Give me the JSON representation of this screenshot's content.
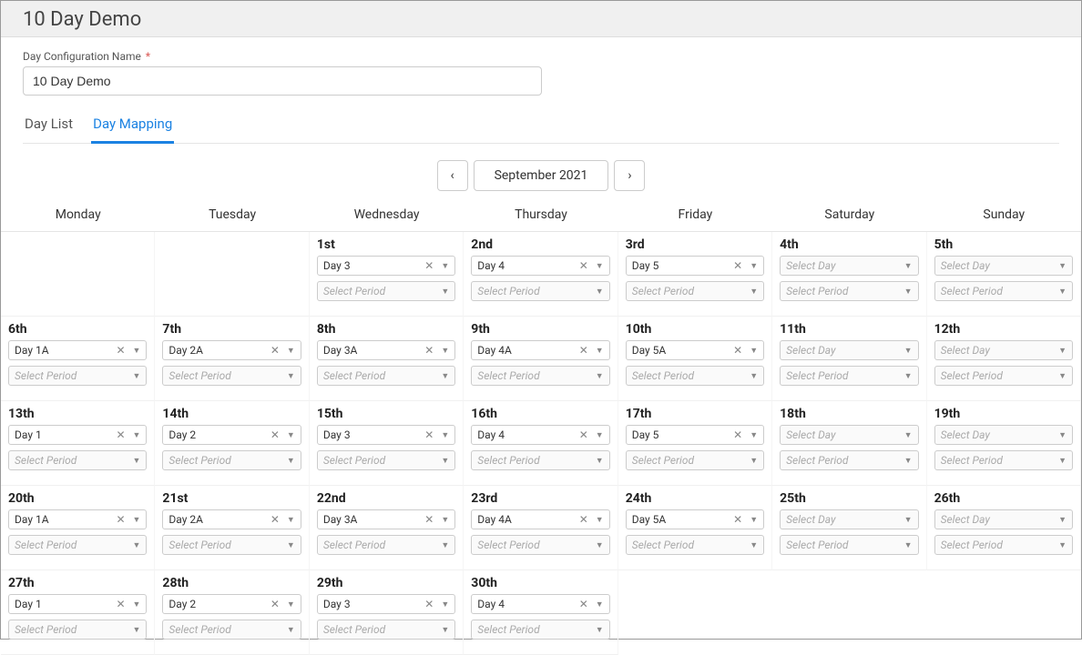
{
  "header": {
    "title": "10 Day Demo"
  },
  "config": {
    "label": "Day Configuration Name",
    "required_marker": "*",
    "value": "10 Day Demo"
  },
  "tabs": {
    "day_list": "Day List",
    "day_mapping": "Day Mapping"
  },
  "month_nav": {
    "label": "September 2021",
    "prev_glyph": "‹",
    "next_glyph": "›"
  },
  "weekdays": [
    "Monday",
    "Tuesday",
    "Wednesday",
    "Thursday",
    "Friday",
    "Saturday",
    "Sunday"
  ],
  "placeholders": {
    "select_day": "Select Day",
    "select_period": "Select Period"
  },
  "glyphs": {
    "clear": "✕",
    "caret": "▼"
  },
  "cells": [
    {
      "date": "",
      "day": "",
      "period": ""
    },
    {
      "date": "",
      "day": "",
      "period": ""
    },
    {
      "date": "1st",
      "day": "Day 3",
      "period": ""
    },
    {
      "date": "2nd",
      "day": "Day 4",
      "period": ""
    },
    {
      "date": "3rd",
      "day": "Day 5",
      "period": ""
    },
    {
      "date": "4th",
      "day": "",
      "period": ""
    },
    {
      "date": "5th",
      "day": "",
      "period": ""
    },
    {
      "date": "6th",
      "day": "Day 1A",
      "period": ""
    },
    {
      "date": "7th",
      "day": "Day 2A",
      "period": ""
    },
    {
      "date": "8th",
      "day": "Day 3A",
      "period": ""
    },
    {
      "date": "9th",
      "day": "Day 4A",
      "period": ""
    },
    {
      "date": "10th",
      "day": "Day 5A",
      "period": ""
    },
    {
      "date": "11th",
      "day": "",
      "period": ""
    },
    {
      "date": "12th",
      "day": "",
      "period": ""
    },
    {
      "date": "13th",
      "day": "Day 1",
      "period": ""
    },
    {
      "date": "14th",
      "day": "Day 2",
      "period": ""
    },
    {
      "date": "15th",
      "day": "Day 3",
      "period": ""
    },
    {
      "date": "16th",
      "day": "Day 4",
      "period": ""
    },
    {
      "date": "17th",
      "day": "Day 5",
      "period": ""
    },
    {
      "date": "18th",
      "day": "",
      "period": ""
    },
    {
      "date": "19th",
      "day": "",
      "period": ""
    },
    {
      "date": "20th",
      "day": "Day 1A",
      "period": ""
    },
    {
      "date": "21st",
      "day": "Day 2A",
      "period": ""
    },
    {
      "date": "22nd",
      "day": "Day 3A",
      "period": ""
    },
    {
      "date": "23rd",
      "day": "Day 4A",
      "period": ""
    },
    {
      "date": "24th",
      "day": "Day 5A",
      "period": ""
    },
    {
      "date": "25th",
      "day": "",
      "period": ""
    },
    {
      "date": "26th",
      "day": "",
      "period": ""
    },
    {
      "date": "27th",
      "day": "Day 1",
      "period": ""
    },
    {
      "date": "28th",
      "day": "Day 2",
      "period": ""
    },
    {
      "date": "29th",
      "day": "Day 3",
      "period": ""
    },
    {
      "date": "30th",
      "day": "Day 4",
      "period": ""
    }
  ]
}
